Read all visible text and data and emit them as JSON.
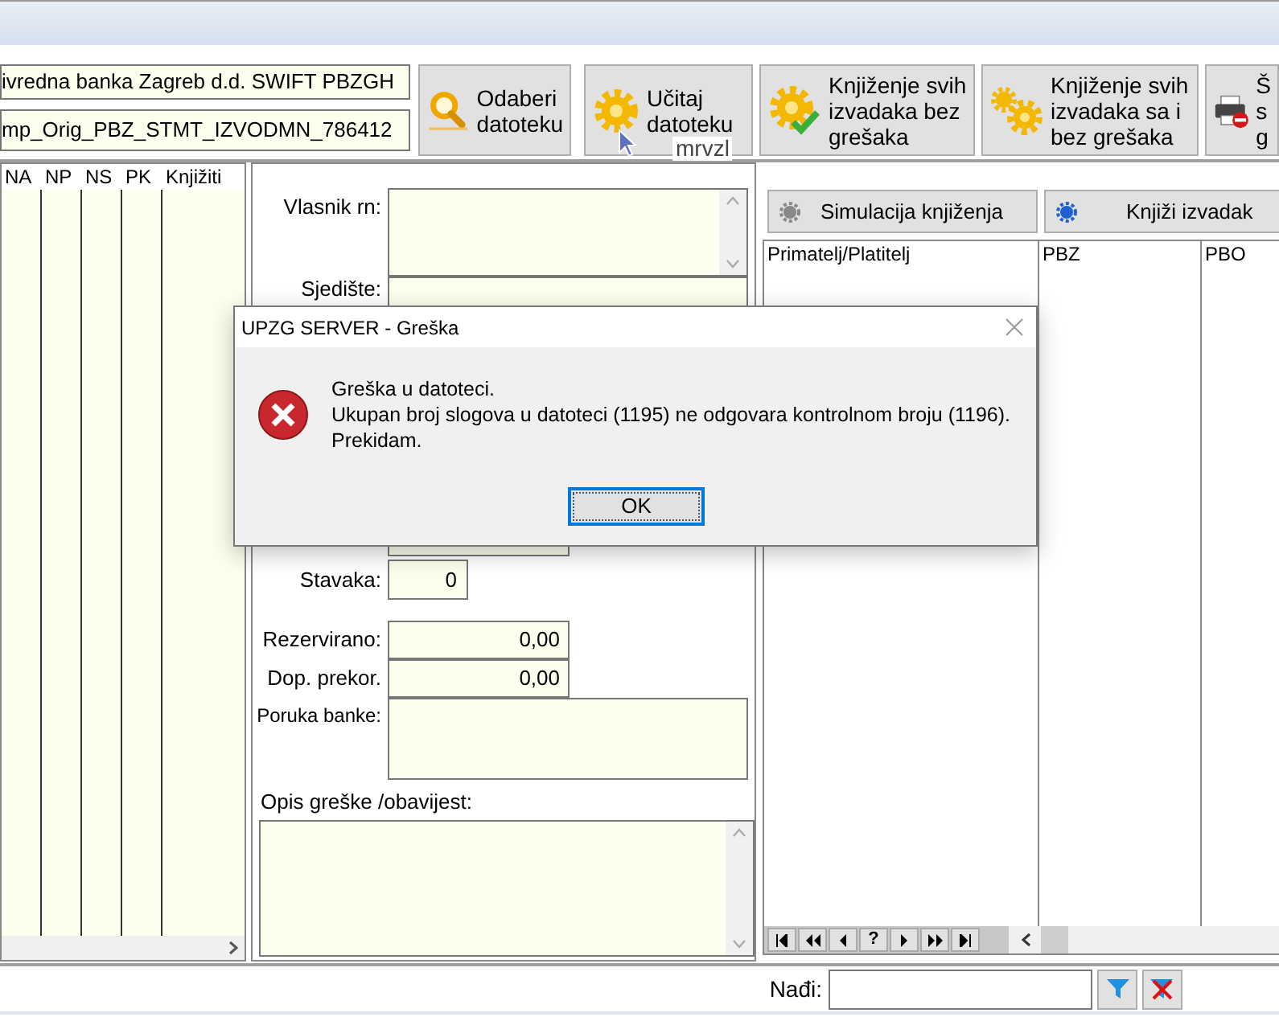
{
  "bank_field": {
    "value": "ivredna banka Zagreb d.d. SWIFT PBZGH"
  },
  "file_field": {
    "value": "mp_Orig_PBZ_STMT_IZVODMN_786412"
  },
  "toolbar": [
    {
      "kind": "search",
      "lines": [
        "Odaberi",
        "datoteku"
      ]
    },
    {
      "kind": "gear",
      "lines": [
        "Učitaj",
        "datoteku"
      ]
    },
    {
      "kind": "gear-check",
      "lines": [
        "Knjiženje svih",
        "izvadaka bez",
        "grešaka"
      ]
    },
    {
      "kind": "gears",
      "lines": [
        "Knjiženje svih",
        "izvadaka sa i",
        "bez grešaka"
      ]
    },
    {
      "kind": "printer",
      "lines": [
        "Š",
        "s",
        "g"
      ]
    }
  ],
  "tooltip": "mrvzl",
  "left_grid": {
    "columns": [
      "NA",
      "NP",
      "NS",
      "PK",
      "Knjižiti"
    ]
  },
  "form": {
    "owner_label": "Vlasnik rn:",
    "seat_label": "Sjedište:",
    "items_label": "Stavaka:",
    "items_value": "0",
    "reserved_label": "Rezervirano:",
    "reserved_value": "0,00",
    "overdraft_label": "Dop. prekor.",
    "overdraft_value": "0,00",
    "bank_message_label": "Poruka banke:",
    "error_label": "Opis greške /obavijest:"
  },
  "actions": [
    {
      "kind": "simulate",
      "label": "Simulacija knjiženja"
    },
    {
      "kind": "post",
      "label": "Knjiži izvadak"
    }
  ],
  "entries_grid": {
    "columns": [
      "Primatelj/Platitelj",
      "PBZ",
      "PBO"
    ]
  },
  "navigator": {
    "help_label": "?"
  },
  "search": {
    "label": "Nađi:"
  },
  "dialog": {
    "title": "UPZG SERVER - Greška",
    "lines": [
      "Greška u datoteci.",
      "Ukupan broj slogova u datoteci (1195) ne odgovara kontrolnom broju (1196).",
      "Prekidam."
    ],
    "button": "OK"
  }
}
